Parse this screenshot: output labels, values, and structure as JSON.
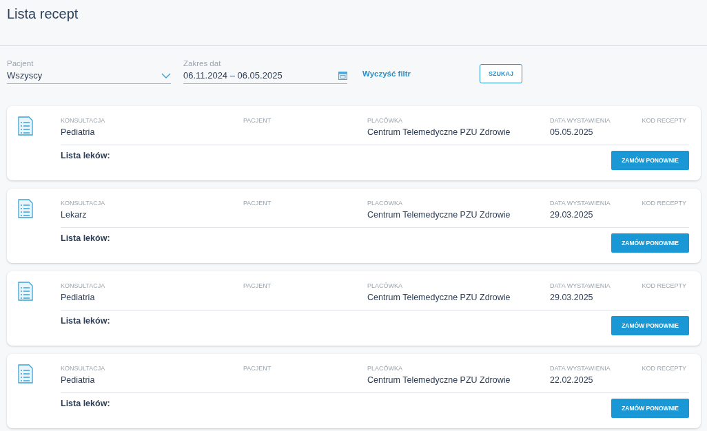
{
  "title": "Lista recept",
  "filters": {
    "patient": {
      "label": "Pacjent",
      "value": "Wszyscy"
    },
    "dates": {
      "label": "Zakres dat",
      "value": "06.11.2024 – 06.05.2025"
    },
    "clear_link": "Wyczyść filtr",
    "search_button": "SZUKAJ"
  },
  "prescriptions": [
    {
      "fields": [
        {
          "label": "KONSULTACJA",
          "value": "Pediatria"
        },
        {
          "label": "PACJENT"
        },
        {
          "label": "PLACÓWKA",
          "value": "Centrum Telemedyczne PZU Zdrowie"
        },
        {
          "label": "DATA WYSTAWIENIA",
          "value": "05.05.2025"
        },
        {
          "label": "KOD RECEPTY"
        }
      ],
      "drugs_label": "Lista leków:",
      "button": "ZAMÓW PONOWNIE"
    },
    {
      "fields": [
        {
          "label": "KONSULTACJA",
          "value": "Lekarz"
        },
        {
          "label": "PACJENT"
        },
        {
          "label": "PLACÓWKA",
          "value": "Centrum Telemedyczne PZU Zdrowie"
        },
        {
          "label": "DATA WYSTAWIENIA",
          "value": "29.03.2025"
        },
        {
          "label": "KOD RECEPTY"
        }
      ],
      "drugs_label": "Lista leków:",
      "button": "ZAMÓW PONOWNIE"
    },
    {
      "fields": [
        {
          "label": "KONSULTACJA",
          "value": "Pediatria"
        },
        {
          "label": "PACJENT"
        },
        {
          "label": "PLACÓWKA",
          "value": "Centrum Telemedyczne PZU Zdrowie"
        },
        {
          "label": "DATA WYSTAWIENIA",
          "value": "29.03.2025"
        },
        {
          "label": "KOD RECEPTY"
        }
      ],
      "drugs_label": "Lista leków:",
      "button": "ZAMÓW PONOWNIE"
    },
    {
      "fields": [
        {
          "label": "KONSULTACJA",
          "value": "Pediatria"
        },
        {
          "label": "PACJENT"
        },
        {
          "label": "PLACÓWKA",
          "value": "Centrum Telemedyczne PZU Zdrowie"
        },
        {
          "label": "DATA WYSTAWIENIA",
          "value": "22.02.2025"
        },
        {
          "label": "KOD RECEPTY"
        }
      ],
      "drugs_label": "Lista leków:",
      "button": "ZAMÓW PONOWNIE"
    }
  ]
}
